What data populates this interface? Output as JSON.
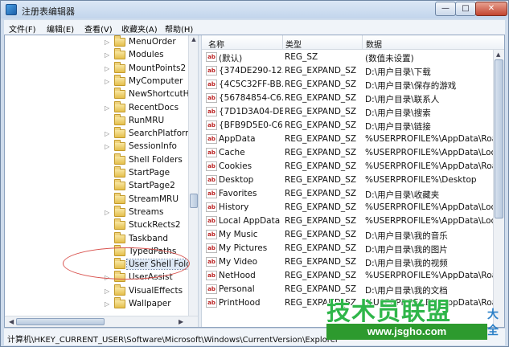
{
  "window": {
    "title": "注册表编辑器",
    "min_glyph": "—",
    "max_glyph": "□",
    "close_glyph": "✕"
  },
  "menu": [
    {
      "label": "文件(F)"
    },
    {
      "label": "编辑(E)"
    },
    {
      "label": "查看(V)"
    },
    {
      "label": "收藏夹(A)"
    },
    {
      "label": "帮助(H)"
    }
  ],
  "tree": {
    "items": [
      {
        "label": "MenuOrder",
        "expander": "▷"
      },
      {
        "label": "Modules",
        "expander": "▷"
      },
      {
        "label": "MountPoints2",
        "expander": "▷"
      },
      {
        "label": "MyComputer",
        "expander": "▷"
      },
      {
        "label": "NewShortcutHa",
        "expander": ""
      },
      {
        "label": "RecentDocs",
        "expander": "▷"
      },
      {
        "label": "RunMRU",
        "expander": ""
      },
      {
        "label": "SearchPlatform",
        "expander": "▷"
      },
      {
        "label": "SessionInfo",
        "expander": "▷"
      },
      {
        "label": "Shell Folders",
        "expander": ""
      },
      {
        "label": "StartPage",
        "expander": ""
      },
      {
        "label": "StartPage2",
        "expander": ""
      },
      {
        "label": "StreamMRU",
        "expander": ""
      },
      {
        "label": "Streams",
        "expander": "▷"
      },
      {
        "label": "StuckRects2",
        "expander": ""
      },
      {
        "label": "Taskband",
        "expander": ""
      },
      {
        "label": "TypedPaths",
        "expander": ""
      },
      {
        "label": "User Shell Folde",
        "expander": "",
        "selected": true
      },
      {
        "label": "UserAssist",
        "expander": "▷"
      },
      {
        "label": "VisualEffects",
        "expander": "▷"
      },
      {
        "label": "Wallpaper",
        "expander": "▷"
      }
    ]
  },
  "list": {
    "columns": {
      "name": "名称",
      "type": "类型",
      "data": "数据"
    },
    "icon_text": "ab",
    "rows": [
      {
        "name": "(默认)",
        "type": "REG_SZ",
        "data": "(数值未设置)"
      },
      {
        "name": "{374DE290-12...",
        "type": "REG_EXPAND_SZ",
        "data": "D:\\用户目录\\下载"
      },
      {
        "name": "{4C5C32FF-BB...",
        "type": "REG_EXPAND_SZ",
        "data": "D:\\用户目录\\保存的游戏"
      },
      {
        "name": "{56784854-C6...",
        "type": "REG_EXPAND_SZ",
        "data": "D:\\用户目录\\联系人"
      },
      {
        "name": "{7D1D3A04-DE...",
        "type": "REG_EXPAND_SZ",
        "data": "D:\\用户目录\\搜索"
      },
      {
        "name": "{BFB9D5E0-C6...",
        "type": "REG_EXPAND_SZ",
        "data": "D:\\用户目录\\链接"
      },
      {
        "name": "AppData",
        "type": "REG_EXPAND_SZ",
        "data": "%USERPROFILE%\\AppData\\Roam"
      },
      {
        "name": "Cache",
        "type": "REG_EXPAND_SZ",
        "data": "%USERPROFILE%\\AppData\\Local\\"
      },
      {
        "name": "Cookies",
        "type": "REG_EXPAND_SZ",
        "data": "%USERPROFILE%\\AppData\\Roam"
      },
      {
        "name": "Desktop",
        "type": "REG_EXPAND_SZ",
        "data": "%USERPROFILE%\\Desktop"
      },
      {
        "name": "Favorites",
        "type": "REG_EXPAND_SZ",
        "data": "D:\\用户目录\\收藏夹"
      },
      {
        "name": "History",
        "type": "REG_EXPAND_SZ",
        "data": "%USERPROFILE%\\AppData\\Local\\"
      },
      {
        "name": "Local AppData",
        "type": "REG_EXPAND_SZ",
        "data": "%USERPROFILE%\\AppData\\Local"
      },
      {
        "name": "My Music",
        "type": "REG_EXPAND_SZ",
        "data": "D:\\用户目录\\我的音乐"
      },
      {
        "name": "My Pictures",
        "type": "REG_EXPAND_SZ",
        "data": "D:\\用户目录\\我的图片"
      },
      {
        "name": "My Video",
        "type": "REG_EXPAND_SZ",
        "data": "D:\\用户目录\\我的视频"
      },
      {
        "name": "NetHood",
        "type": "REG_EXPAND_SZ",
        "data": "%USERPROFILE%\\AppData\\Roam"
      },
      {
        "name": "Personal",
        "type": "REG_EXPAND_SZ",
        "data": "D:\\用户目录\\我的文档"
      },
      {
        "name": "PrintHood",
        "type": "REG_EXPAND_SZ",
        "data": "%USERPROFILE%\\AppData\\Roam"
      }
    ]
  },
  "statusbar": {
    "path": "计算机\\HKEY_CURRENT_USER\\Software\\Microsoft\\Windows\\CurrentVersion\\Explorer"
  },
  "watermark": {
    "big": "技术员联盟",
    "side": "大全",
    "url": "www.jsgho.com"
  }
}
